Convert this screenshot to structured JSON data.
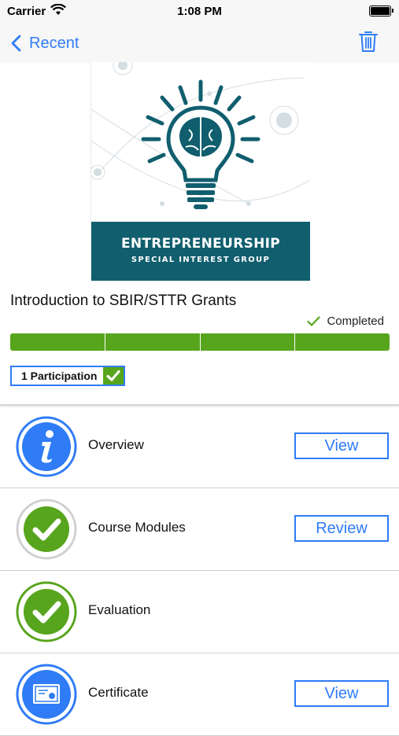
{
  "status_bar": {
    "carrier": "Carrier",
    "time": "1:08 PM"
  },
  "nav": {
    "back_label": "Recent"
  },
  "course": {
    "image_title": "ENTREPRENEURSHIP",
    "image_subtitle": "SPECIAL INTEREST GROUP",
    "title": "Introduction to SBIR/STTR Grants",
    "status": "Completed",
    "progress_segments": 4,
    "progress_completed": 4,
    "participation_label": "1 Participation"
  },
  "rows": [
    {
      "label": "Overview",
      "button": "View",
      "icon": "info-icon"
    },
    {
      "label": "Course Modules",
      "button": "Review",
      "icon": "check-circle-icon"
    },
    {
      "label": "Evaluation",
      "button": "",
      "icon": "check-circle-icon"
    },
    {
      "label": "Certificate",
      "button": "View",
      "icon": "certificate-icon"
    }
  ],
  "colors": {
    "accent": "#2f7cf6",
    "success": "#57a51d",
    "banner": "#105e6e"
  }
}
